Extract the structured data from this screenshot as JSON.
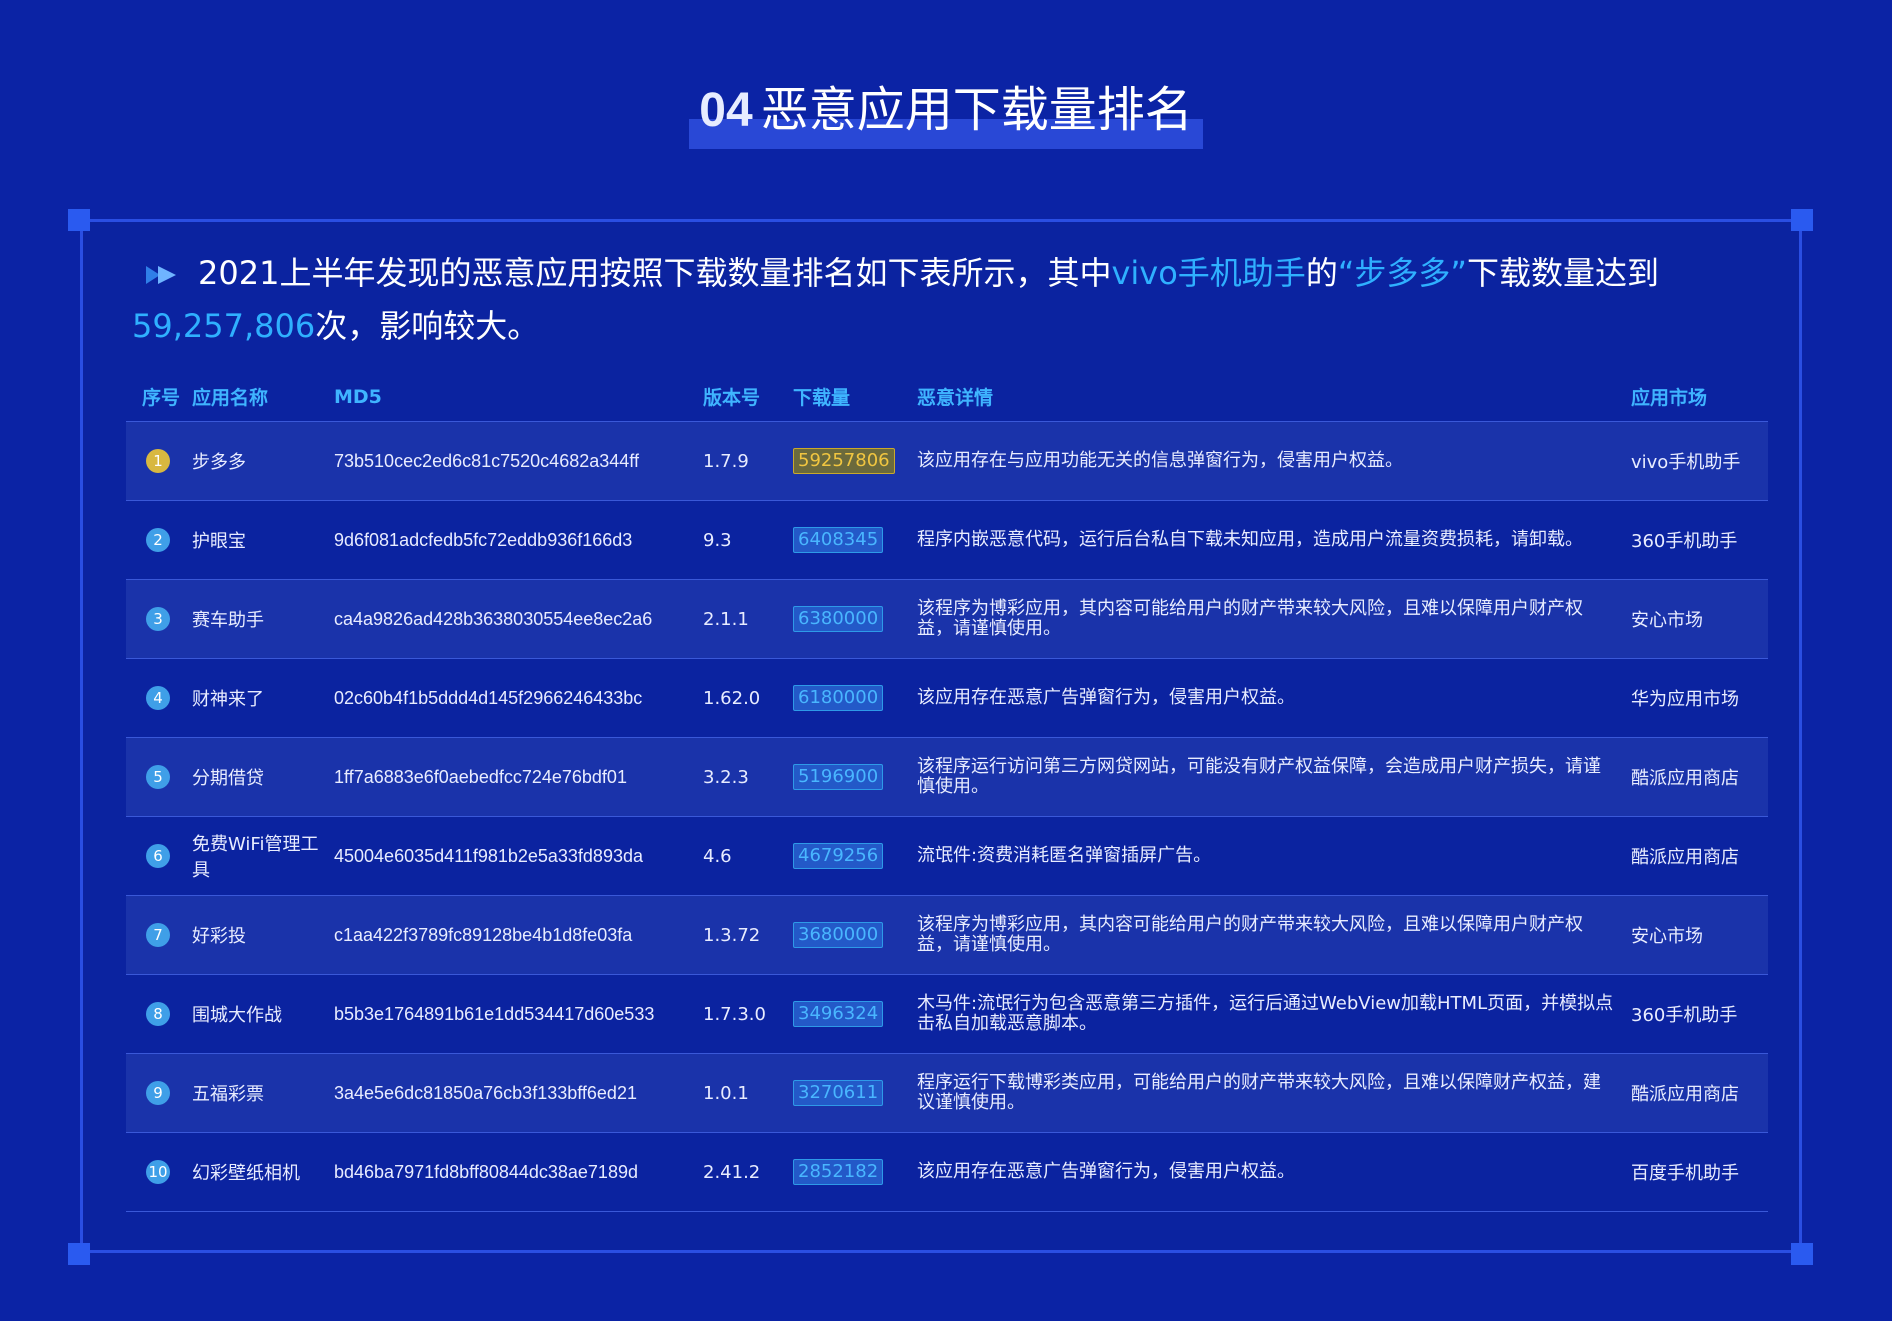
{
  "title": {
    "number": "04",
    "text": "恶意应用下载量排名"
  },
  "intro": {
    "part1": "2021上半年发现的恶意应用按照下载数量排名如下表所示，其中",
    "market": "vivo手机助手",
    "part2": "的",
    "app": "“步多多”",
    "part3": "下载数量达到",
    "count": "59,257,806",
    "part4": "次，影响较大。"
  },
  "colors": {
    "background": "#0b23a5",
    "accent": "#2fb0ff",
    "gold": "#d8b840"
  },
  "table": {
    "headers": [
      "序号",
      "应用名称",
      "MD5",
      "版本号",
      "下载量",
      "恶意详情",
      "应用市场"
    ],
    "rows": [
      {
        "no": "1",
        "name": "步多多",
        "md5": "73b510cec2ed6c81c7520c4682a344ff",
        "version": "1.7.9",
        "downloads": "59257806",
        "detail": "该应用存在与应用功能无关的信息弹窗行为，侵害用户权益。",
        "market": "vivo手机助手"
      },
      {
        "no": "2",
        "name": "护眼宝",
        "md5": "9d6f081adcfedb5fc72eddb936f166d3",
        "version": "9.3",
        "downloads": "6408345",
        "detail": "程序内嵌恶意代码，运行后台私自下载未知应用，造成用户流量资费损耗，请卸载。",
        "market": "360手机助手"
      },
      {
        "no": "3",
        "name": "赛车助手",
        "md5": "ca4a9826ad428b3638030554ee8ec2a6",
        "version": "2.1.1",
        "downloads": "6380000",
        "detail": "该程序为博彩应用，其内容可能给用户的财产带来较大风险，且难以保障用户财产权益，请谨慎使用。",
        "market": "安心市场"
      },
      {
        "no": "4",
        "name": "财神来了",
        "md5": "02c60b4f1b5ddd4d145f2966246433bc",
        "version": "1.62.0",
        "downloads": "6180000",
        "detail": "该应用存在恶意广告弹窗行为，侵害用户权益。",
        "market": "华为应用市场"
      },
      {
        "no": "5",
        "name": "分期借贷",
        "md5": "1ff7a6883e6f0aebedfcc724e76bdf01",
        "version": "3.2.3",
        "downloads": "5196900",
        "detail": "该程序运行访问第三方网贷网站，可能没有财产权益保障，会造成用户财产损失，请谨慎使用。",
        "market": "酷派应用商店"
      },
      {
        "no": "6",
        "name": "免费WiFi管理工具",
        "md5": "45004e6035d411f981b2e5a33fd893da",
        "version": "4.6",
        "downloads": "4679256",
        "detail": "流氓件:资费消耗匿名弹窗插屏广告。",
        "market": "酷派应用商店"
      },
      {
        "no": "7",
        "name": "好彩投",
        "md5": "c1aa422f3789fc89128be4b1d8fe03fa",
        "version": "1.3.72",
        "downloads": "3680000",
        "detail": "该程序为博彩应用，其内容可能给用户的财产带来较大风险，且难以保障用户财产权益，请谨慎使用。",
        "market": "安心市场"
      },
      {
        "no": "8",
        "name": "围城大作战",
        "md5": "b5b3e1764891b61e1dd534417d60e533",
        "version": "1.7.3.0",
        "downloads": "3496324",
        "detail": "木马件:流氓行为包含恶意第三方插件，运行后通过WebView加载HTML页面，并模拟点击私自加载恶意脚本。",
        "market": "360手机助手"
      },
      {
        "no": "9",
        "name": "五福彩票",
        "md5": "3a4e5e6dc81850a76cb3f133bff6ed21",
        "version": "1.0.1",
        "downloads": "3270611",
        "detail": "程序运行下载博彩类应用，可能给用户的财产带来较大风险，且难以保障财产权益，建议谨慎使用。",
        "market": "酷派应用商店"
      },
      {
        "no": "10",
        "name": "幻彩壁纸相机",
        "md5": "bd46ba7971fd8bff80844dc38ae7189d",
        "version": "2.41.2",
        "downloads": "2852182",
        "detail": "该应用存在恶意广告弹窗行为，侵害用户权益。",
        "market": "百度手机助手"
      }
    ]
  }
}
